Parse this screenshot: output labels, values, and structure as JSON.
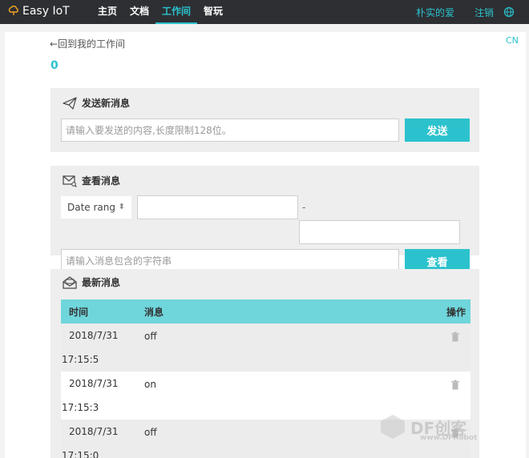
{
  "nav": {
    "brand": "Easy IoT",
    "items": [
      {
        "label": "主页"
      },
      {
        "label": "文档"
      },
      {
        "label": "工作间"
      },
      {
        "label": "智玩"
      }
    ],
    "active_index": 2,
    "user": "朴实的爱",
    "logout": "注销"
  },
  "page": {
    "back_link": "←回到我的工作间",
    "lang": "CN",
    "count": "0"
  },
  "send": {
    "title": "发送新消息",
    "placeholder": "请输入要发送的内容,长度限制128位。",
    "button": "发送"
  },
  "view": {
    "title": "查看消息",
    "date_select": "Date rang",
    "separator": "-",
    "search_placeholder": "请输入消息包含的字符串",
    "query_button": "查看"
  },
  "latest": {
    "title": "最新消息",
    "columns": {
      "time": "时间",
      "message": "消息",
      "action": "操作"
    },
    "rows": [
      {
        "date": "2018/7/31",
        "time": "17:15:5",
        "message": "off"
      },
      {
        "date": "2018/7/31",
        "time": "17:15:3",
        "message": "on"
      },
      {
        "date": "2018/7/31",
        "time": "17:15:0",
        "message": "off"
      }
    ]
  },
  "watermark": {
    "text": "DF创客",
    "sub": "www.DFRobot"
  },
  "colors": {
    "accent": "#2bc2cd",
    "topbar": "#2d2f33",
    "table_header": "#6fd6dc"
  }
}
